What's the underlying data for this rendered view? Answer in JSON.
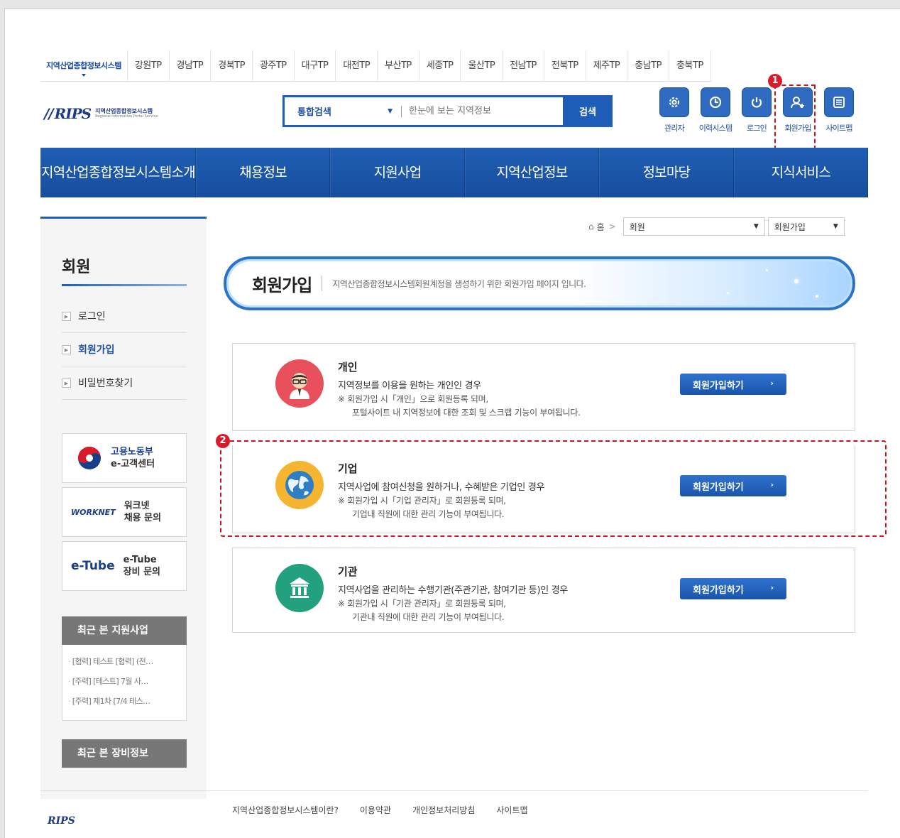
{
  "tp_tabs": [
    "지역산업종합정보시스템",
    "강원TP",
    "경남TP",
    "경북TP",
    "광주TP",
    "대구TP",
    "대전TP",
    "부산TP",
    "세종TP",
    "울산TP",
    "전남TP",
    "전북TP",
    "제주TP",
    "충남TP",
    "충북TP"
  ],
  "logo": {
    "mark": "RIPS",
    "ko": "지역산업종합정보시스템",
    "en": "Regional Information Portal Service"
  },
  "search": {
    "category": "통합검색",
    "placeholder": "한눈에 보는 지역정보",
    "button": "검색"
  },
  "quick_menu": [
    {
      "label": "관리자",
      "icon": "gear-icon"
    },
    {
      "label": "이력시스템",
      "icon": "clock-icon"
    },
    {
      "label": "로그인",
      "icon": "power-icon"
    },
    {
      "label": "회원가입",
      "icon": "add-user-icon"
    },
    {
      "label": "사이트맵",
      "icon": "sitemap-icon"
    }
  ],
  "markers": {
    "one": "1",
    "two": "2"
  },
  "gnb": [
    "지역산업종합정보시스템소개",
    "채용정보",
    "지원사업",
    "지역산업정보",
    "정보마당",
    "지식서비스"
  ],
  "sidebar": {
    "title": "회원",
    "menu": [
      "로그인",
      "회원가입",
      "비밀번호찾기"
    ],
    "active": "회원가입",
    "banners": [
      {
        "line1": "고용노동부",
        "line2": "e-고객센터",
        "logo": "moel-logo"
      },
      {
        "line1": "워크넷",
        "line2": "채용 문의",
        "logo": "WORKNET"
      },
      {
        "line1": "e-Tube",
        "line2": "장비 문의",
        "logo": "e-Tube"
      }
    ],
    "recent_support": {
      "title": "최근 본 지원사업",
      "items": [
        "[협력] 테스트 [협력] (전…",
        "[주력] [테스트] 7월 사…",
        "[주력] 제1차 [7/4 테스…"
      ]
    },
    "recent_equipment": {
      "title": "최근 본 장비정보"
    }
  },
  "breadcrumb": {
    "home": "홈",
    "sep": ">",
    "level1": "회원",
    "level2": "회원가입"
  },
  "title_banner": {
    "title": "회원가입",
    "desc": "지역산업종합정보시스템회원계정을 생성하기 위한 회원가입 페이지 입니다."
  },
  "join_types": [
    {
      "title": "개인",
      "desc": "지역정보를 이용을 원하는 개인인 경우",
      "note1": "※ 회원가입 시「개인」으로 회원등록 되며,",
      "note2": "포털사이트 내 지역정보에 대한 조회 및 스크랩 기능이 부여됩니다.",
      "button": "회원가입하기",
      "color": "#e8505b"
    },
    {
      "title": "기업",
      "desc": "지역사업에 참여신청을 원하거나, 수혜받은 기업인 경우",
      "note1": "※ 회원가입 시「기업 관리자」로 회원등록 되며,",
      "note2": "기업내 직원에 대한 관리 기능이 부여됩니다.",
      "button": "회원가입하기",
      "color": "#f5b531"
    },
    {
      "title": "기관",
      "desc": "지역사업을 관리하는 수행기관(주관기관, 참여기관 등)인 경우",
      "note1": "※ 회원가입 시「기관 관리자」로 회원등록 되며,",
      "note2": "기관내 직원에 대한 관리 기능이 부여됩니다.",
      "button": "회원가입하기",
      "color": "#23a07e"
    }
  ],
  "footer": {
    "logo": "RIPS",
    "links": [
      "지역산업종합정보시스템이란?",
      "이용약관",
      "개인정보처리방침",
      "사이트맵"
    ]
  }
}
